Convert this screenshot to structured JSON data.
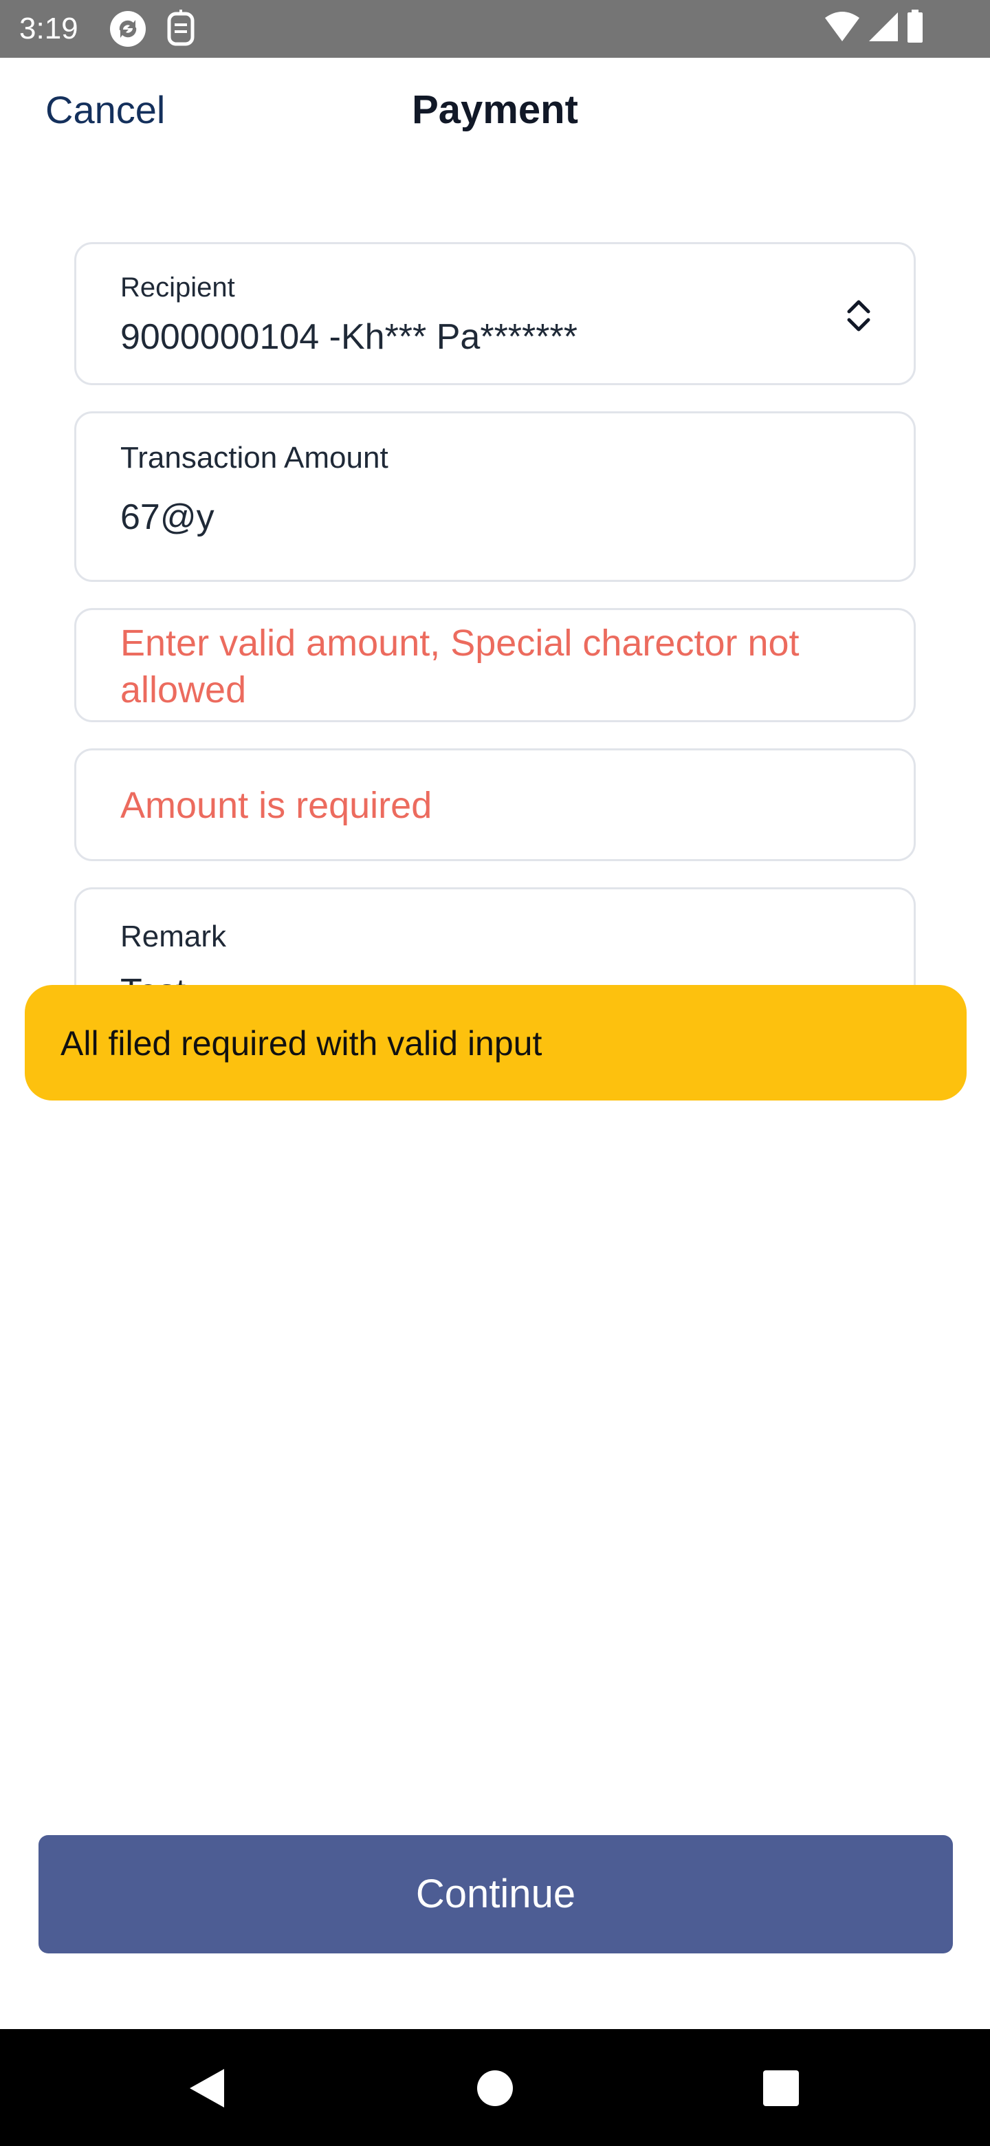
{
  "status_bar": {
    "time": "3:19",
    "icons": [
      "sync-icon",
      "message-icon",
      "wifi-icon",
      "signal-icon",
      "battery-icon"
    ]
  },
  "header": {
    "cancel_label": "Cancel",
    "title": "Payment"
  },
  "form": {
    "recipient": {
      "label": "Recipient",
      "value": "9000000104 -Kh*** Pa*******",
      "icon": "unfold-selector-icon"
    },
    "amount": {
      "label": "Transaction Amount",
      "value": "67@y"
    },
    "errors": {
      "invalid_amount": "Enter valid amount, Special charector not allowed",
      "amount_required": "Amount is required"
    },
    "remark": {
      "label": "Remark",
      "value": "Test"
    }
  },
  "toast": {
    "message": "All filed required with valid input",
    "color": "#fdc10e"
  },
  "actions": {
    "continue_label": "Continue",
    "continue_color": "#4d5d94"
  },
  "colors": {
    "error_text": "#ec6b5e",
    "accent_text": "#14305c"
  },
  "nav_bar": {
    "icons": [
      "back-icon",
      "home-icon",
      "recents-icon"
    ]
  }
}
